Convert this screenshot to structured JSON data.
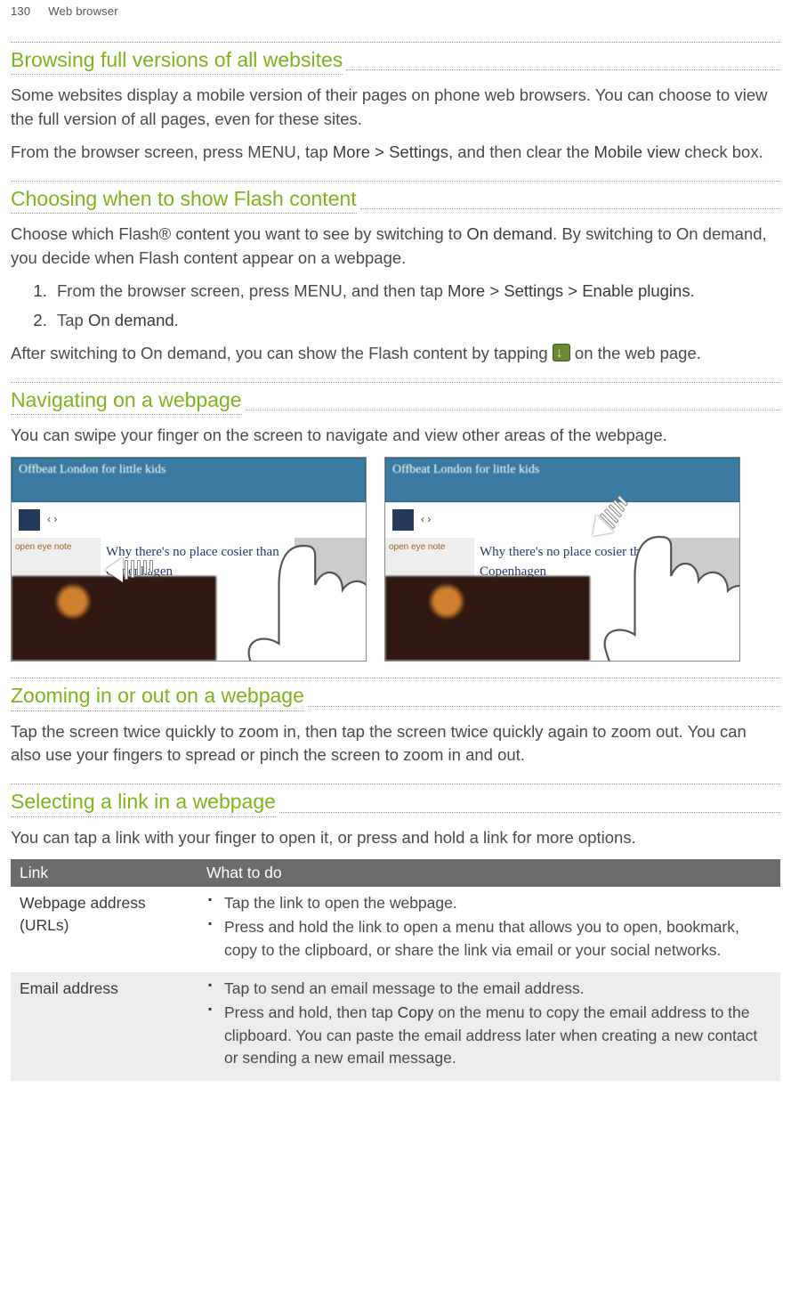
{
  "header": {
    "page_number": "130",
    "chapter": "Web browser"
  },
  "s1": {
    "title": "Browsing full versions of all websites",
    "p1": "Some websites display a mobile version of their pages on phone web browsers. You can choose to view the full version of all pages, even for these sites.",
    "p2a": "From the browser screen, press MENU, tap ",
    "p2b": "More > Settings",
    "p2c": ", and then clear the ",
    "p2d": "Mobile view",
    "p2e": " check box."
  },
  "s2": {
    "title": "Choosing when to show Flash content",
    "p1a": "Choose which Flash® content you want to see by switching to ",
    "p1b": "On demand",
    "p1c": ". By switching to On demand, you decide when Flash content appear on a webpage.",
    "steps": {
      "s1a": "From the browser screen, press MENU, and then tap ",
      "s1b": "More > Settings > Enable plugins",
      "s1c": ".",
      "s2a": "Tap ",
      "s2b": "On demand",
      "s2c": "."
    },
    "p2a": "After switching to On demand, you can show the Flash content by tapping ",
    "p2b": " on the web page."
  },
  "s3": {
    "title": "Navigating on a webpage",
    "p1": "You can swipe your finger on the screen to navigate and view other areas of the webpage.",
    "img_title": "Offbeat London for little kids",
    "img_headline": "Why there's no place cosier than Copenhagen",
    "img_sidebar": "open eye note"
  },
  "s4": {
    "title": "Zooming in or out on a webpage",
    "p1": "Tap the screen twice quickly to zoom in, then tap the screen twice quickly again to zoom out. You can also use your fingers to spread or pinch the screen to zoom in and out."
  },
  "s5": {
    "title": "Selecting a link in a webpage",
    "p1": "You can tap a link with your finger to open it, or press and hold a link for more options.",
    "table": {
      "h1": "Link",
      "h2": "What to do",
      "r1_label": "Webpage address (URLs)",
      "r1_i1": "Tap the link to open the webpage.",
      "r1_i2": "Press and hold the link to open a menu that allows you to open, bookmark, copy to the clipboard, or share the link via email or your social networks.",
      "r2_label": "Email address",
      "r2_i1": "Tap to send an email message to the email address.",
      "r2_i2a": "Press and hold, then tap ",
      "r2_i2b": "Copy",
      "r2_i2c": " on the menu to copy the email address to the clipboard. You can paste the email address later when creating a new contact or sending a new email message."
    }
  }
}
